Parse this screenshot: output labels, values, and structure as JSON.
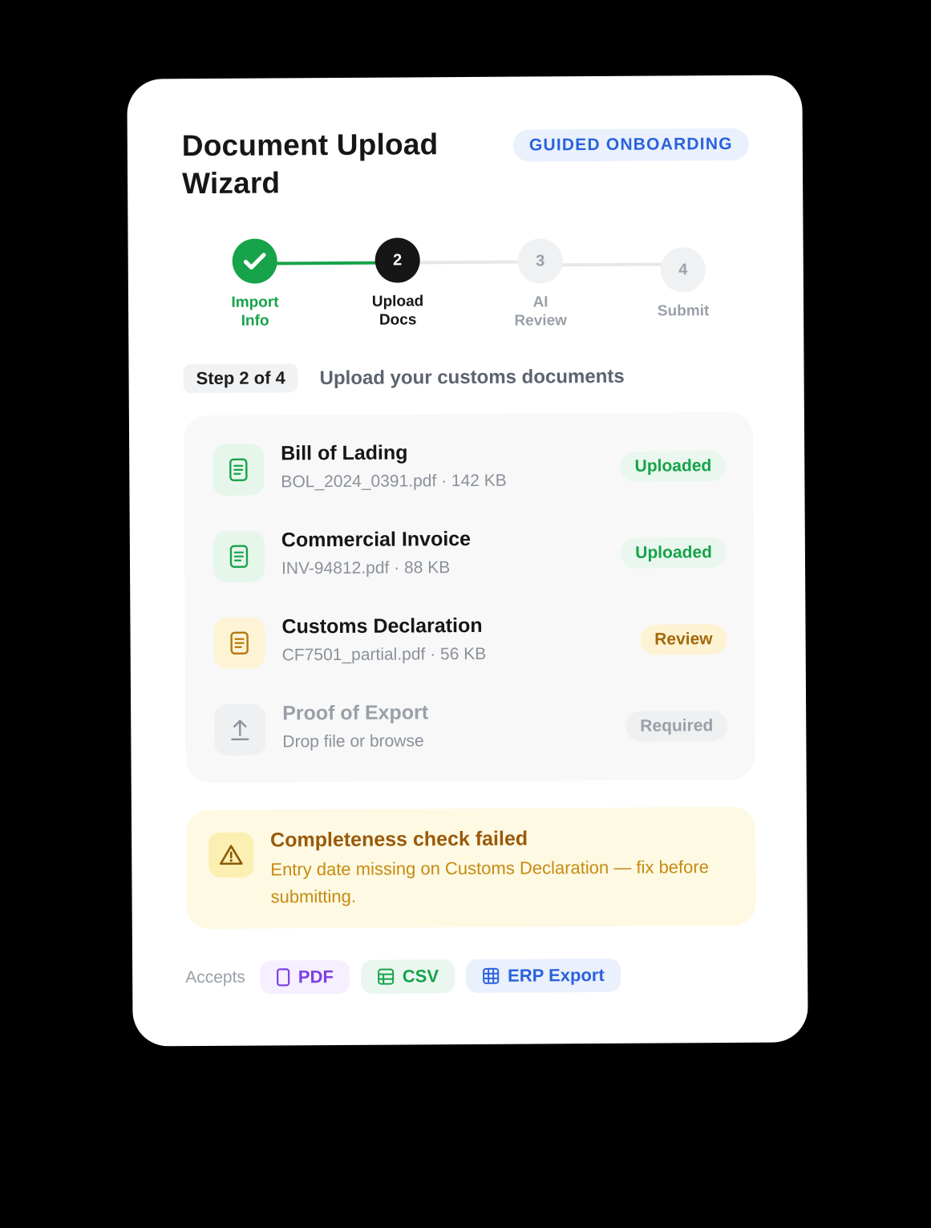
{
  "header": {
    "title": "Document Upload Wizard",
    "badge": "GUIDED ONBOARDING"
  },
  "stepper": {
    "steps": [
      {
        "number": "",
        "label_line1": "Import",
        "label_line2": "Info",
        "state": "done"
      },
      {
        "number": "2",
        "label_line1": "Upload",
        "label_line2": "Docs",
        "state": "current"
      },
      {
        "number": "3",
        "label_line1": "AI",
        "label_line2": "Review",
        "state": "todo"
      },
      {
        "number": "4",
        "label_line1": "Submit",
        "label_line2": "",
        "state": "todo"
      }
    ]
  },
  "step_info": {
    "pill": "Step 2 of 4",
    "heading": "Upload your customs documents"
  },
  "documents": [
    {
      "name": "Bill of Lading",
      "meta": "BOL_2024_0391.pdf · 142 KB",
      "status": "Uploaded",
      "icon": "document-icon"
    },
    {
      "name": "Commercial Invoice",
      "meta": "INV-94812.pdf · 88 KB",
      "status": "Uploaded",
      "icon": "document-icon"
    },
    {
      "name": "Customs Declaration",
      "meta": "CF7501_partial.pdf · 56 KB",
      "status": "Review",
      "icon": "document-icon"
    },
    {
      "name": "Proof of Export",
      "meta": "Drop file or browse",
      "status": "Required",
      "icon": "upload-icon"
    }
  ],
  "alert": {
    "title": "Completeness check failed",
    "text": "Entry date missing on Customs Declaration — fix before submitting.",
    "icon": "warning-icon"
  },
  "accepts": {
    "label": "Accepts",
    "formats": [
      {
        "label": "PDF",
        "icon": "file-icon"
      },
      {
        "label": "CSV",
        "icon": "spreadsheet-icon"
      },
      {
        "label": "ERP Export",
        "icon": "table-grid-icon"
      }
    ]
  },
  "colors": {
    "success": "#17a34a",
    "warning": "#a5680a",
    "accent": "#2a62dc",
    "pdf": "#7b3fe4"
  }
}
